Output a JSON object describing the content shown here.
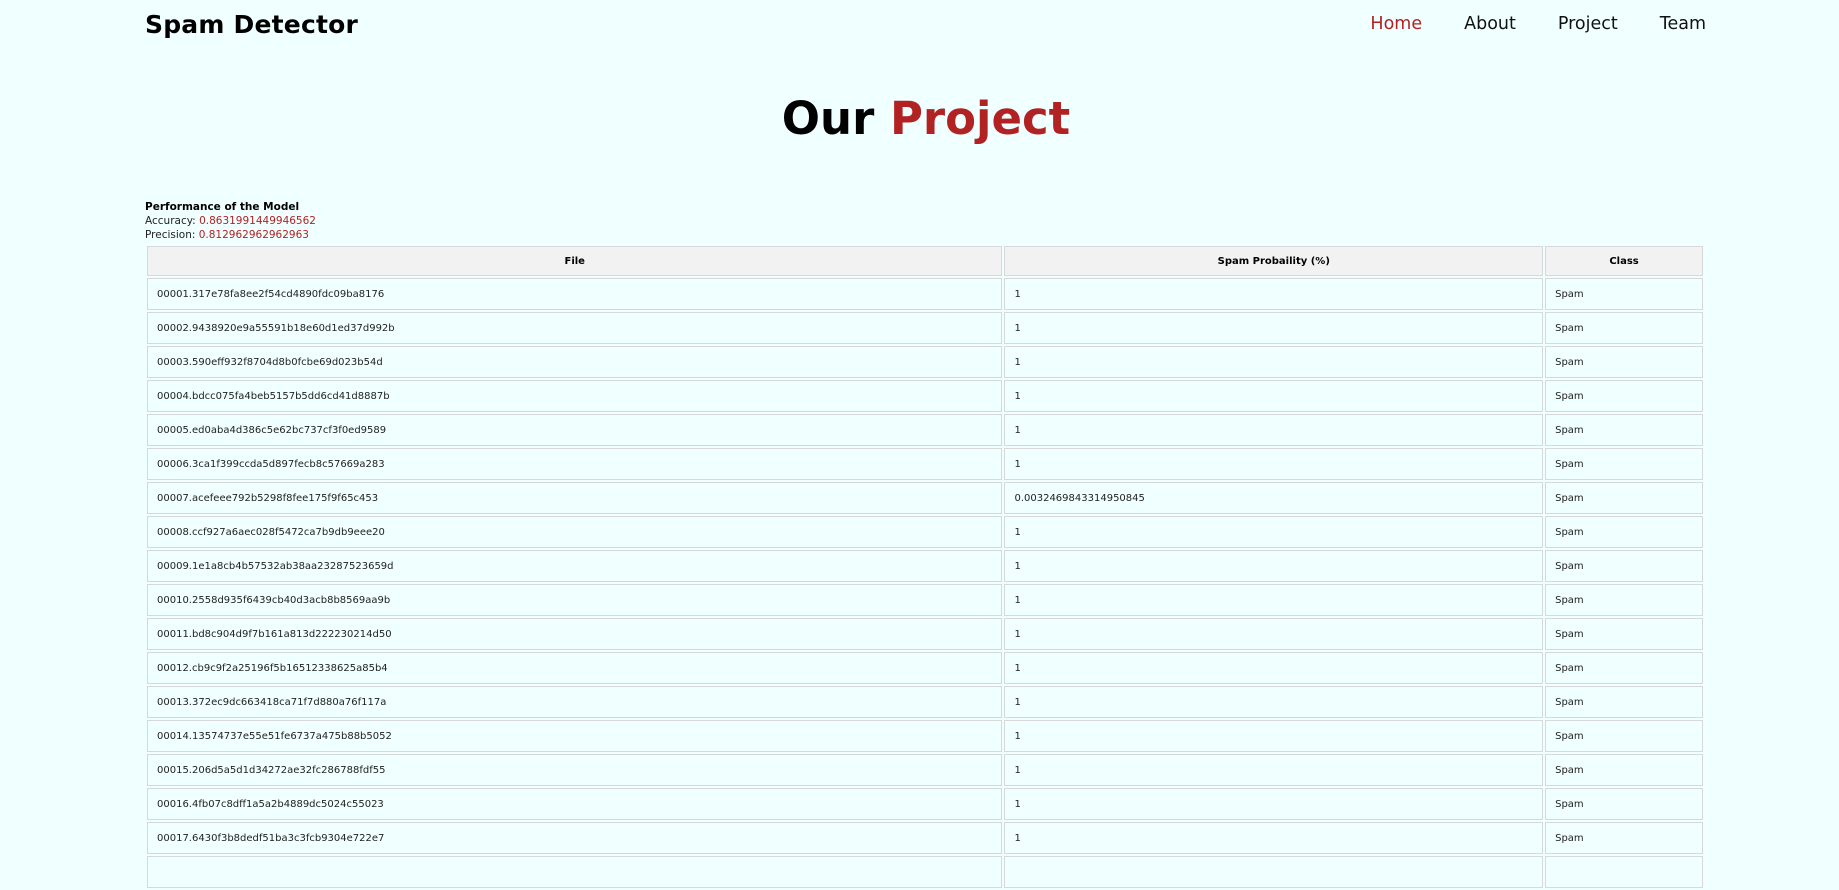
{
  "navbar": {
    "brand": "Spam Detector",
    "links": [
      {
        "label": "Home",
        "active": true
      },
      {
        "label": "About",
        "active": false
      },
      {
        "label": "Project",
        "active": false
      },
      {
        "label": "Team",
        "active": false
      }
    ]
  },
  "title": {
    "part1": "Our",
    "part2": "Project"
  },
  "performance": {
    "heading": "Performance of the Model",
    "accuracy_label": "Accuracy:",
    "accuracy_value": "0.8631991449946562",
    "precision_label": "Precision:",
    "precision_value": "0.812962962962963"
  },
  "table": {
    "headers": [
      "File",
      "Spam Probaility (%)",
      "Class"
    ],
    "rows": [
      {
        "file": "00001.317e78fa8ee2f54cd4890fdc09ba8176",
        "prob": "1",
        "class": "Spam"
      },
      {
        "file": "00002.9438920e9a55591b18e60d1ed37d992b",
        "prob": "1",
        "class": "Spam"
      },
      {
        "file": "00003.590eff932f8704d8b0fcbe69d023b54d",
        "prob": "1",
        "class": "Spam"
      },
      {
        "file": "00004.bdcc075fa4beb5157b5dd6cd41d8887b",
        "prob": "1",
        "class": "Spam"
      },
      {
        "file": "00005.ed0aba4d386c5e62bc737cf3f0ed9589",
        "prob": "1",
        "class": "Spam"
      },
      {
        "file": "00006.3ca1f399ccda5d897fecb8c57669a283",
        "prob": "1",
        "class": "Spam"
      },
      {
        "file": "00007.acefeee792b5298f8fee175f9f65c453",
        "prob": "0.0032469843314950845",
        "class": "Spam"
      },
      {
        "file": "00008.ccf927a6aec028f5472ca7b9db9eee20",
        "prob": "1",
        "class": "Spam"
      },
      {
        "file": "00009.1e1a8cb4b57532ab38aa23287523659d",
        "prob": "1",
        "class": "Spam"
      },
      {
        "file": "00010.2558d935f6439cb40d3acb8b8569aa9b",
        "prob": "1",
        "class": "Spam"
      },
      {
        "file": "00011.bd8c904d9f7b161a813d222230214d50",
        "prob": "1",
        "class": "Spam"
      },
      {
        "file": "00012.cb9c9f2a25196f5b16512338625a85b4",
        "prob": "1",
        "class": "Spam"
      },
      {
        "file": "00013.372ec9dc663418ca71f7d880a76f117a",
        "prob": "1",
        "class": "Spam"
      },
      {
        "file": "00014.13574737e55e51fe6737a475b88b5052",
        "prob": "1",
        "class": "Spam"
      },
      {
        "file": "00015.206d5a5d1d34272ae32fc286788fdf55",
        "prob": "1",
        "class": "Spam"
      },
      {
        "file": "00016.4fb07c8dff1a5a2b4889dc5024c55023",
        "prob": "1",
        "class": "Spam"
      },
      {
        "file": "00017.6430f3b8dedf51ba3c3fcb9304e722e7",
        "prob": "1",
        "class": "Spam"
      },
      {
        "file": "",
        "prob": "",
        "class": ""
      }
    ]
  }
}
